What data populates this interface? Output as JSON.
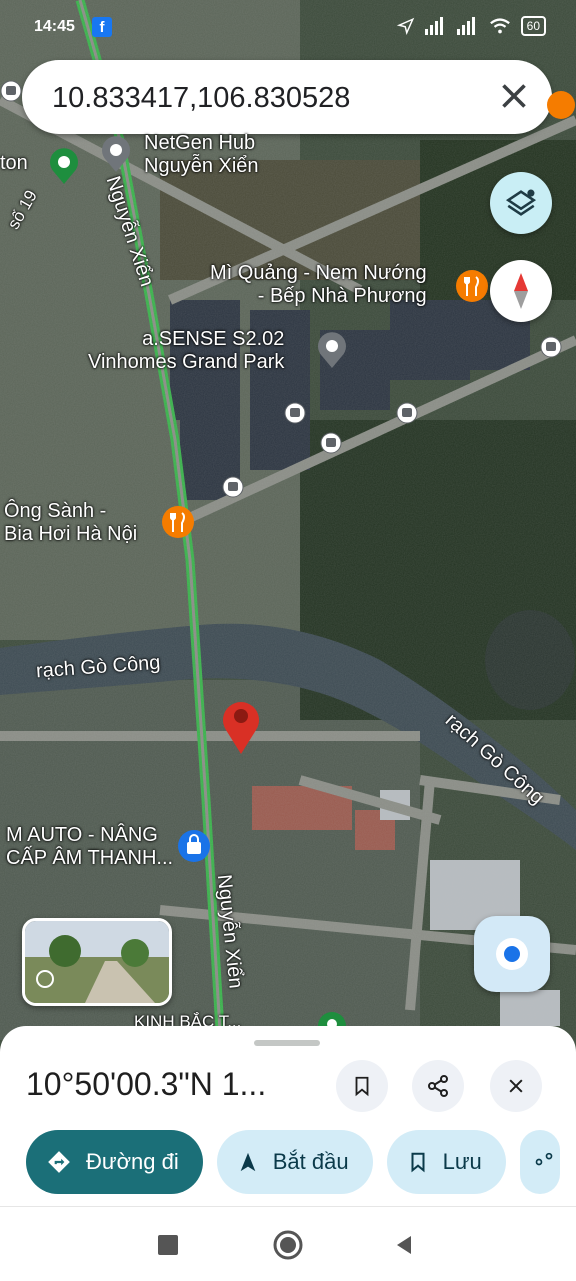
{
  "status_bar": {
    "time": "14:45",
    "fb_glyph": "f",
    "battery": "60"
  },
  "search": {
    "query": "10.833417,106.830528"
  },
  "map_labels": {
    "netgen": [
      "NetGen Hub",
      "Nguyễn Xiển"
    ],
    "ton": "ton",
    "so19": "số 19",
    "street_nguyen_xien": "Nguyễn Xiển",
    "mi_quang": [
      "Mì Quảng - Nem Nướng",
      "- Bếp Nhà Phương"
    ],
    "asense": [
      "a.SENSE S2.02",
      "Vinhomes Grand Park"
    ],
    "ong_sanh": [
      "Ông Sành -",
      "Bia Hơi Hà Nội"
    ],
    "river_left": "rạch Gò Công",
    "river_right": "rạch Gò Công",
    "m_auto": [
      "M AUTO - NÂNG",
      "CẤP ÂM THANH..."
    ],
    "kinh_bac": "KINH BẮC T..."
  },
  "sheet": {
    "title": "10°50'00.3\"N 1...",
    "actions": {
      "directions": "Đường đi",
      "start": "Bắt đầu",
      "save": "Lưu"
    }
  },
  "colors": {
    "accent": "#1b6f78",
    "pin": "#d93025",
    "chip": "#d3ecf7",
    "route": "#38b24a"
  }
}
